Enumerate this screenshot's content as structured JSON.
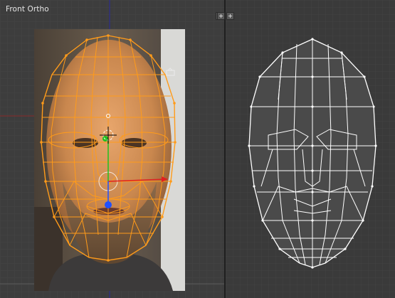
{
  "viewport_left": {
    "title": "Front Ortho"
  },
  "viewport_right": {
    "title": ""
  },
  "icons": {
    "split_left": "plus-icon",
    "split_right": "plus-icon",
    "camera": "camera-icon"
  },
  "colors": {
    "background": "#3d3d3d",
    "grid": "#474747",
    "mesh_selected": "#ff9b1a",
    "mesh_wire": "#ffffff",
    "axis_x": "#e02020",
    "axis_y": "#20c020",
    "axis_z": "#2050ff"
  }
}
